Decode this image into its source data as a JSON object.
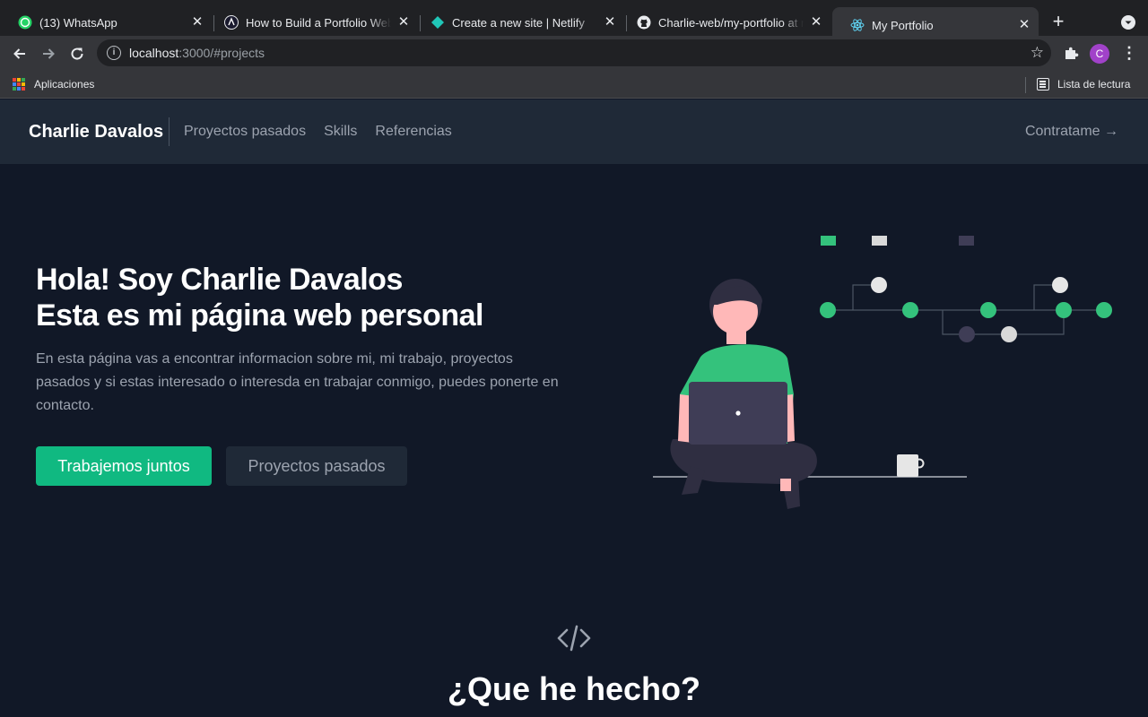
{
  "browser": {
    "tabs": [
      {
        "title": "(13) WhatsApp",
        "icon": "whatsapp-icon"
      },
      {
        "title": "How to Build a Portfolio Website",
        "icon": "astro-icon"
      },
      {
        "title": "Create a new site | Netlify",
        "icon": "netlify-icon"
      },
      {
        "title": "Charlie-web/my-portfolio at main",
        "icon": "github-icon"
      },
      {
        "title": "My Portfolio",
        "icon": "react-icon",
        "active": true
      }
    ],
    "url_host": "localhost",
    "url_rest": ":3000/#projects",
    "bookmarks": {
      "apps_label": "Aplicaciones",
      "reading_list_label": "Lista de lectura"
    },
    "profile_initial": "C"
  },
  "site": {
    "brand": "Charlie Davalos",
    "nav": [
      {
        "label": "Proyectos pasados"
      },
      {
        "label": "Skills"
      },
      {
        "label": "Referencias"
      }
    ],
    "hire_label": "Contratame →",
    "hero": {
      "title_line1": "Hola! Soy Charlie Davalos",
      "title_line2": "Esta es mi página web personal",
      "description": "En esta página vas a encontrar informacion sobre mi, mi trabajo, proyectos pasados y si estas interesado o interesda en trabajar conmigo, puedes ponerte en contacto.",
      "primary_button": "Trabajemos juntos",
      "secondary_button": "Proyectos pasados"
    },
    "section_title": "¿Que he hecho?",
    "colors": {
      "accent": "#10b981",
      "background": "#111827",
      "nav_bg": "#1f2937"
    }
  }
}
